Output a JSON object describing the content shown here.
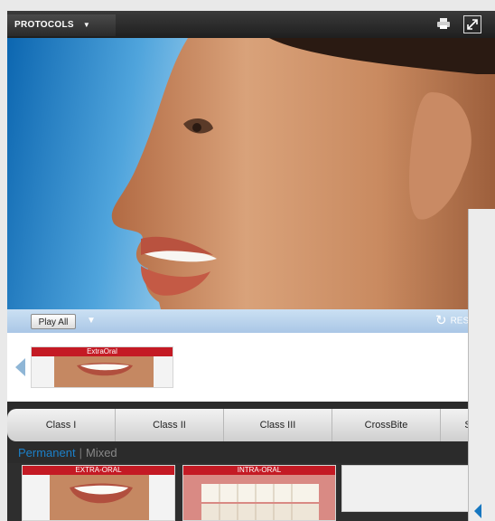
{
  "header": {
    "protocols_label": "PROTOCOLS",
    "dropdown_caret": "▼",
    "print_icon": "print-icon",
    "expand_icon": "expand-icon"
  },
  "playbar": {
    "play_all_label": "Play All",
    "dropdown_caret": "▼",
    "reset_label": "RESI",
    "reset_icon": "refresh-icon"
  },
  "strip1": {
    "thumbnails": [
      {
        "label": "ExtraOral"
      }
    ]
  },
  "tabs": {
    "items": [
      {
        "label": "Class I"
      },
      {
        "label": "Class II"
      },
      {
        "label": "Class III"
      },
      {
        "label": "CrossBite"
      },
      {
        "label": "S"
      }
    ]
  },
  "subnav": {
    "active": "Permanent",
    "separator": "|",
    "inactive": "Mixed"
  },
  "strip2": {
    "thumbnails": [
      {
        "label": "EXTRA-ORAL"
      },
      {
        "label": "INTRA-ORAL"
      }
    ]
  },
  "colors": {
    "accent_blue": "#1c80c8",
    "band_red": "#c41a24",
    "topbar": "#2b2b2b"
  }
}
